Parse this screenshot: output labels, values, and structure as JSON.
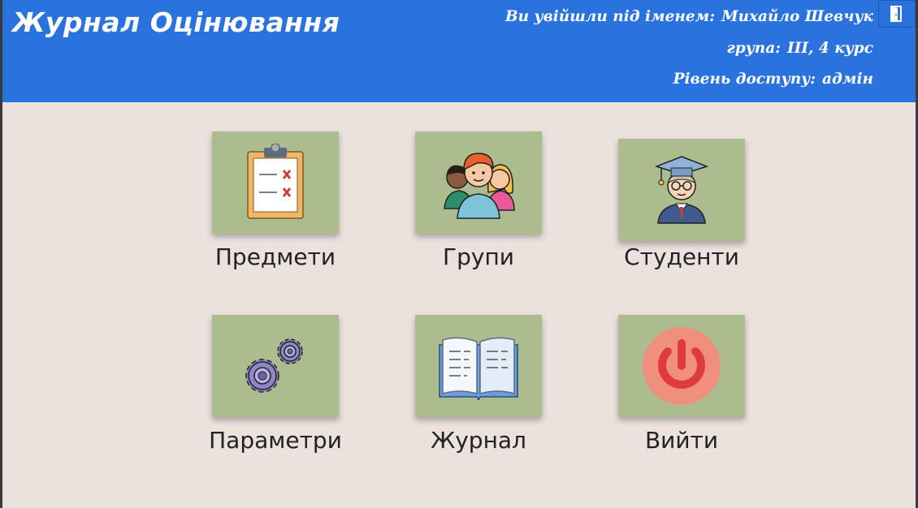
{
  "app": {
    "title": "Журнал Оцінювання"
  },
  "user": {
    "name_label": "Ви увійшли під іменем:",
    "name": "Михайло Шевчук",
    "group_label": "група:",
    "group": "ІІІ, 4 курс",
    "access_label": "Рівень доступу:",
    "access": "адмін"
  },
  "tiles": [
    {
      "label": "Предмети",
      "icon": "clipboard-icon"
    },
    {
      "label": "Групи",
      "icon": "people-group-icon"
    },
    {
      "label": "Студенти",
      "icon": "graduate-student-icon"
    },
    {
      "label": "Параметри",
      "icon": "gears-icon"
    },
    {
      "label": "Журнал",
      "icon": "open-book-icon"
    },
    {
      "label": "Вийти",
      "icon": "power-icon"
    }
  ],
  "colors": {
    "header": "#2a72de",
    "background": "#ebe1dd",
    "tile": "#abbd8e",
    "accent_red": "#e53e3e"
  }
}
